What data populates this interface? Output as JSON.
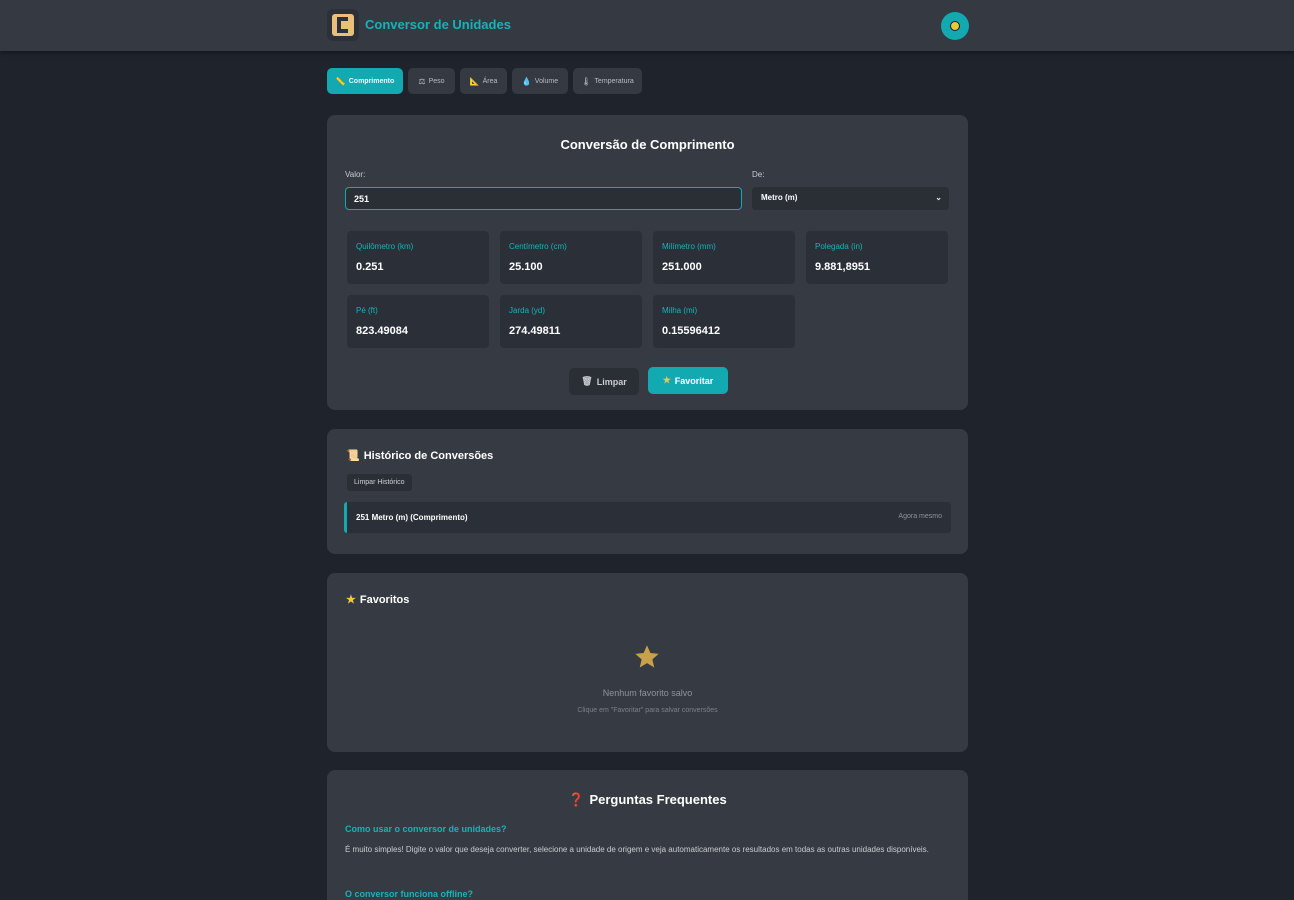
{
  "header": {
    "title": "Conversor de Unidades",
    "logo_letter": "C",
    "theme_toggle_icon": "sun-icon"
  },
  "tabs": [
    {
      "icon": "ruler-icon",
      "glyph": "📏",
      "label": "Comprimento",
      "active": true
    },
    {
      "icon": "scale-icon",
      "glyph": "⚖",
      "label": "Peso",
      "active": false
    },
    {
      "icon": "triangle-ruler-icon",
      "glyph": "📐",
      "label": "Área",
      "active": false
    },
    {
      "icon": "droplet-icon",
      "glyph": "💧",
      "label": "Volume",
      "active": false
    },
    {
      "icon": "thermometer-icon",
      "glyph": "🌡",
      "label": "Temperatura",
      "active": false
    }
  ],
  "converter": {
    "title": "Conversão de Comprimento",
    "value_label": "Valor:",
    "value": "251",
    "from_label": "De:",
    "from_unit": "Metro (m)",
    "results": [
      {
        "unit": "Quilômetro (km)",
        "value": "0.251"
      },
      {
        "unit": "Centímetro (cm)",
        "value": "25.100"
      },
      {
        "unit": "Milímetro (mm)",
        "value": "251.000"
      },
      {
        "unit": "Polegada (in)",
        "value": "9.881,8951"
      },
      {
        "unit": "Pé (ft)",
        "value": "823.49084"
      },
      {
        "unit": "Jarda (yd)",
        "value": "274.49811"
      },
      {
        "unit": "Milha (mi)",
        "value": "0.15596412"
      }
    ],
    "clear_label": "Limpar",
    "clear_icon": "trash-icon",
    "favorite_label": "Favoritar",
    "favorite_icon": "star-icon"
  },
  "history": {
    "title": "Histórico de Conversões",
    "icon": "scroll-icon",
    "clear_label": "Limpar Histórico",
    "items": [
      {
        "text": "251 Metro (m) (Comprimento)",
        "time": "Agora mesmo"
      }
    ]
  },
  "favorites": {
    "title": "Favoritos",
    "icon": "star-icon",
    "empty_text": "Nenhum favorito salvo",
    "empty_hint": "Clique em \"Favoritar\" para salvar conversões"
  },
  "faq": {
    "title": "Perguntas Frequentes",
    "icon": "question-icon",
    "items": [
      {
        "q": "Como usar o conversor de unidades?",
        "a": "É muito simples! Digite o valor que deseja converter, selecione a unidade de origem e veja automaticamente os resultados em todas as outras unidades disponíveis."
      },
      {
        "q": "O conversor funciona offline?",
        "a": ""
      }
    ]
  },
  "colors": {
    "accent": "#13a9b0",
    "background": "#1f242c",
    "card": "#363b43",
    "star": "#c8a24a"
  }
}
